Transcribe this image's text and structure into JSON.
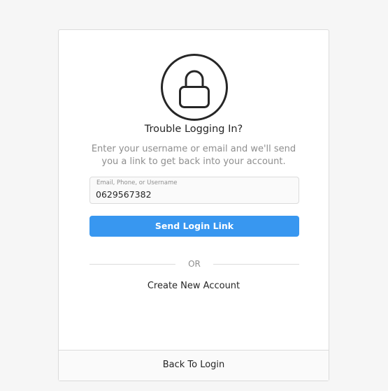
{
  "icons": {
    "header": "lock-icon"
  },
  "title": "Trouble Logging In?",
  "subtitle": "Enter your username or email and we'll send you a link to get back into your account.",
  "input": {
    "label": "Email, Phone, or Username",
    "value": "0629567382"
  },
  "send_button": {
    "label": "Send Login Link"
  },
  "divider": {
    "text": "OR"
  },
  "create_account": {
    "label": "Create New Account"
  },
  "footer": {
    "back_label": "Back To Login"
  },
  "colors": {
    "button": "#3897f0",
    "text": "#262626",
    "muted": "#8e8e8e",
    "border": "#dbdbdb"
  }
}
